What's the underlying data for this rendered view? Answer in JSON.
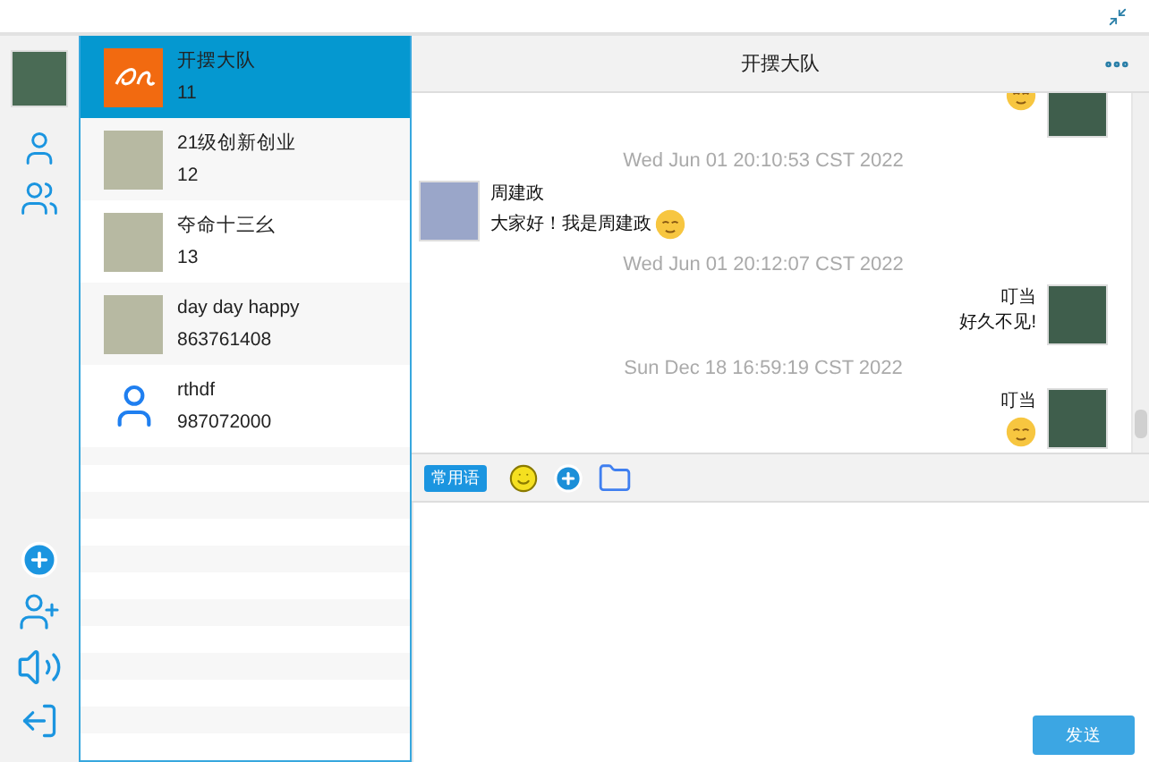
{
  "conversations": [
    {
      "name": "开摆大队",
      "number": "11",
      "kind": "logo",
      "selected": true
    },
    {
      "name": "21级创新创业",
      "number": "12",
      "kind": "photo",
      "selected": false
    },
    {
      "name": "夺命十三幺",
      "number": "13",
      "kind": "photo",
      "selected": false
    },
    {
      "name": "day day happy",
      "number": "863761408",
      "kind": "photo",
      "selected": false
    },
    {
      "name": "rthdf",
      "number": "987072000",
      "kind": "icon",
      "selected": false
    }
  ],
  "chat": {
    "title": "开摆大队",
    "messages": [
      {
        "kind": "outgoing",
        "parts": [
          {
            "kind": "emoji"
          }
        ]
      },
      {
        "kind": "time",
        "text": "Wed Jun 01 20:10:53 CST 2022"
      },
      {
        "kind": "incoming",
        "name": "周建政",
        "parts": [
          {
            "kind": "text",
            "text": "大家好！我是周建政"
          },
          {
            "kind": "emoji"
          }
        ]
      },
      {
        "kind": "time",
        "text": "Wed Jun 01 20:12:07 CST 2022"
      },
      {
        "kind": "outgoing",
        "name": "叮当",
        "parts": [
          {
            "kind": "text",
            "text": "好久不见!"
          }
        ]
      },
      {
        "kind": "time",
        "text": "Sun Dec 18 16:59:19 CST 2022"
      },
      {
        "kind": "outgoing",
        "name": "叮当",
        "parts": [
          {
            "kind": "emoji"
          }
        ]
      }
    ],
    "phrases_button": "常用语",
    "send_button": "发送"
  }
}
